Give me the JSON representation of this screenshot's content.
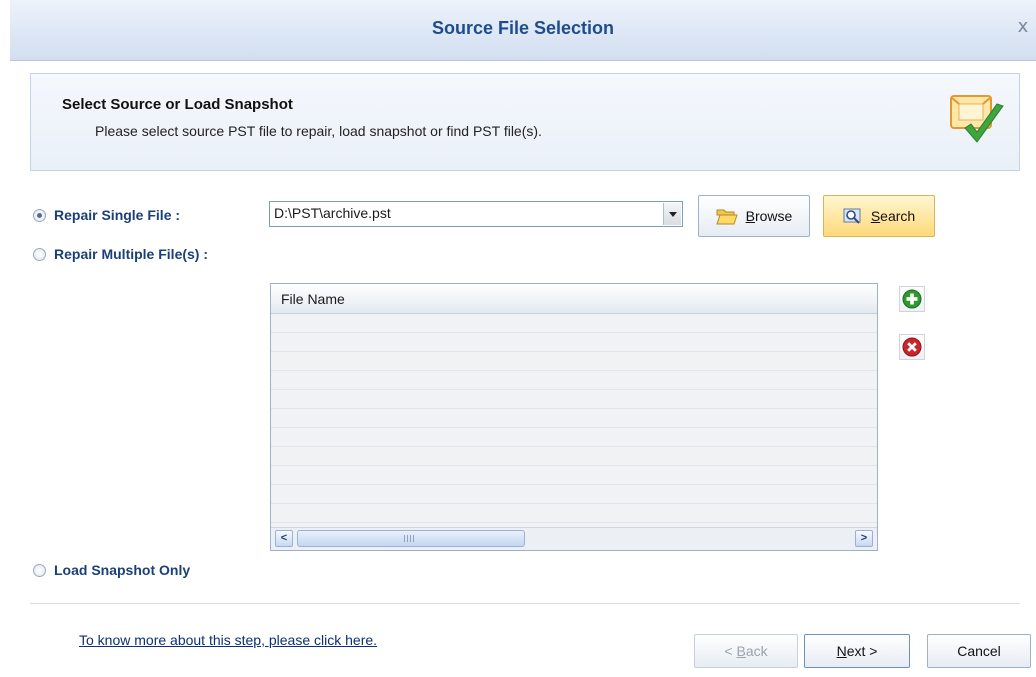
{
  "window": {
    "title": "Source File Selection",
    "close_glyph": "x"
  },
  "header": {
    "title": "Select Source or Load Snapshot",
    "description": "Please select source PST file to repair, load snapshot or find PST file(s).",
    "icon": "email-check-icon"
  },
  "options": {
    "single": {
      "label": "Repair Single File :",
      "selected": true
    },
    "multiple": {
      "label": "Repair Multiple File(s) :",
      "selected": false
    },
    "snapshot": {
      "label": "Load Snapshot Only",
      "selected": false
    }
  },
  "file_path": {
    "value": "D:\\PST\\archive.pst"
  },
  "buttons": {
    "browse_access": "B",
    "browse_rest": "rowse",
    "search_access": "S",
    "search_rest": "earch",
    "back_prefix": "< ",
    "back_access": "B",
    "back_rest": "ack",
    "next_access": "N",
    "next_rest": "ext >",
    "cancel": "Cancel"
  },
  "table": {
    "columns": [
      "File Name"
    ],
    "rows": []
  },
  "help_link": "To know more about this step, please click here.",
  "colors": {
    "title": "#1e4c8f",
    "search_bg": "#ffd97a",
    "add": "#2e9a2e",
    "remove": "#c8252d"
  }
}
